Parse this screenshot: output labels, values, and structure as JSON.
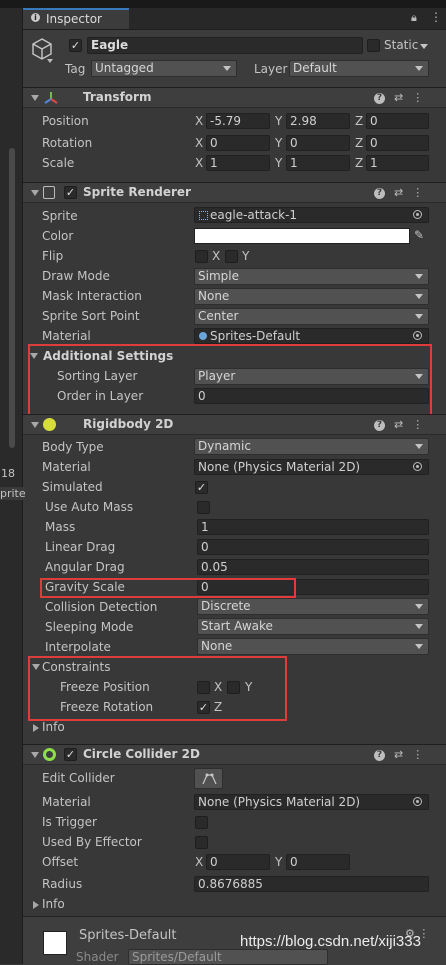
{
  "tab": {
    "label": "Inspector"
  },
  "left_panel": {
    "text_a": "18",
    "text_b": "prite"
  },
  "header": {
    "name": "Eagle",
    "static_label": "Static",
    "tag_label": "Tag",
    "tag_value": "Untagged",
    "layer_label": "Layer",
    "layer_value": "Default"
  },
  "transform": {
    "title": "Transform",
    "position_label": "Position",
    "position": {
      "x": "-5.79",
      "y": "2.98",
      "z": "0"
    },
    "rotation_label": "Rotation",
    "rotation": {
      "x": "0",
      "y": "0",
      "z": "0"
    },
    "scale_label": "Scale",
    "scale": {
      "x": "1",
      "y": "1",
      "z": "1"
    }
  },
  "axis": {
    "x": "X",
    "y": "Y",
    "z": "Z"
  },
  "sprite_renderer": {
    "title": "Sprite Renderer",
    "sprite_label": "Sprite",
    "sprite_value": "eagle-attack-1",
    "color_label": "Color",
    "color_value": "#ffffff",
    "flip_label": "Flip",
    "draw_mode_label": "Draw Mode",
    "draw_mode_value": "Simple",
    "mask_label": "Mask Interaction",
    "mask_value": "None",
    "sort_point_label": "Sprite Sort Point",
    "sort_point_value": "Center",
    "material_label": "Material",
    "material_value": "Sprites-Default",
    "additional_label": "Additional Settings",
    "sorting_layer_label": "Sorting Layer",
    "sorting_layer_value": "Player",
    "order_label": "Order in Layer",
    "order_value": "0"
  },
  "rigidbody": {
    "title": "Rigidbody 2D",
    "body_type_label": "Body Type",
    "body_type_value": "Dynamic",
    "material_label": "Material",
    "material_value": "None (Physics Material 2D)",
    "simulated_label": "Simulated",
    "simulated": true,
    "auto_mass_label": "Use Auto Mass",
    "auto_mass": false,
    "mass_label": "Mass",
    "mass_value": "1",
    "linear_drag_label": "Linear Drag",
    "linear_drag_value": "0",
    "angular_drag_label": "Angular Drag",
    "angular_drag_value": "0.05",
    "gravity_label": "Gravity Scale",
    "gravity_value": "0",
    "collision_label": "Collision Detection",
    "collision_value": "Discrete",
    "sleeping_label": "Sleeping Mode",
    "sleeping_value": "Start Awake",
    "interpolate_label": "Interpolate",
    "interpolate_value": "None",
    "constraints_label": "Constraints",
    "freeze_pos_label": "Freeze Position",
    "freeze_rot_label": "Freeze Rotation",
    "info_label": "Info"
  },
  "circle_collider": {
    "title": "Circle Collider 2D",
    "edit_label": "Edit Collider",
    "material_label": "Material",
    "material_value": "None (Physics Material 2D)",
    "trigger_label": "Is Trigger",
    "effector_label": "Used By Effector",
    "offset_label": "Offset",
    "offset": {
      "x": "0",
      "y": "0"
    },
    "radius_label": "Radius",
    "radius_value": "0.8676885",
    "info_label": "Info"
  },
  "material_footer": {
    "name": "Sprites-Default",
    "shader_label": "Shader",
    "shader_value": "Sprites/Default"
  },
  "watermark": "https://blog.csdn.net/xiji333",
  "colors": {
    "highlight": "#e03c3c",
    "accent": "#3a79bb"
  }
}
